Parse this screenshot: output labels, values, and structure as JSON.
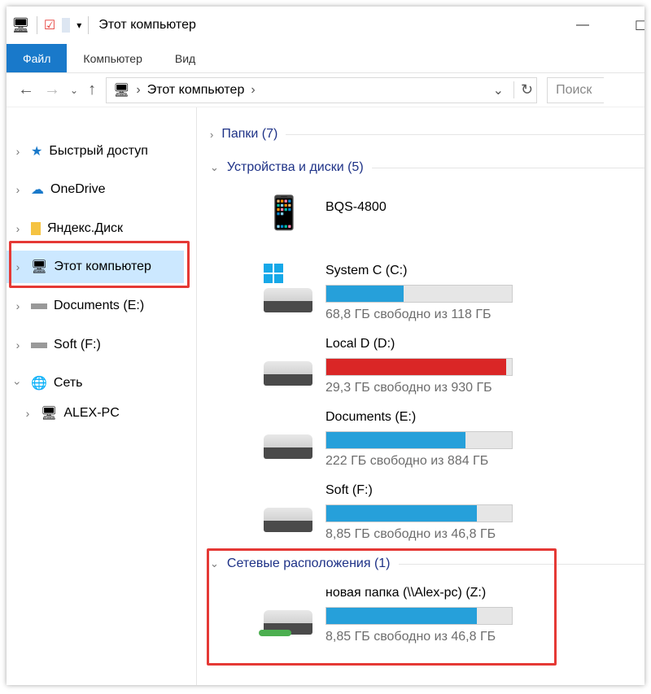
{
  "window": {
    "title": "Этот компьютер"
  },
  "ribbon": {
    "tabs": [
      "Файл",
      "Компьютер",
      "Вид"
    ]
  },
  "address": {
    "path": "Этот компьютер",
    "search_placeholder": "Поиск"
  },
  "sidebar": {
    "items": [
      {
        "label": "Быстрый доступ",
        "icon": "star-icon"
      },
      {
        "label": "OneDrive",
        "icon": "cloud-icon"
      },
      {
        "label": "Яндекс.Диск",
        "icon": "folder-icon"
      },
      {
        "label": "Этот компьютер",
        "icon": "computer-icon",
        "selected": true
      },
      {
        "label": "Documents (E:)",
        "icon": "drive-icon"
      },
      {
        "label": "Soft (F:)",
        "icon": "drive-icon"
      },
      {
        "label": "Сеть",
        "icon": "network-icon",
        "expanded": true
      },
      {
        "label": "ALEX-PC",
        "icon": "computer-icon"
      }
    ]
  },
  "groups": {
    "folders": "Папки (7)",
    "devices": "Устройства и диски (5)",
    "network": "Сетевые расположения (1)"
  },
  "devices": [
    {
      "name": "BQS-4800",
      "icon": "media-player-icon"
    },
    {
      "name": "System C (C:)",
      "free": "68,8 ГБ свободно из 118 ГБ",
      "used_fraction": 0.417,
      "icon": "windows-drive-icon"
    },
    {
      "name": "Local D (D:)",
      "free": "29,3 ГБ свободно из 930 ГБ",
      "used_fraction": 0.968,
      "icon": "drive-icon",
      "warning": true
    },
    {
      "name": "Documents (E:)",
      "free": "222 ГБ свободно из 884 ГБ",
      "used_fraction": 0.749,
      "icon": "drive-icon"
    },
    {
      "name": "Soft (F:)",
      "free": "8,85 ГБ свободно из 46,8 ГБ",
      "used_fraction": 0.811,
      "icon": "drive-icon"
    }
  ],
  "network_locations": [
    {
      "name": "новая папка (\\\\Alex-pc) (Z:)",
      "free": "8,85 ГБ свободно из 46,8 ГБ",
      "used_fraction": 0.811,
      "icon": "network-drive-icon"
    }
  ],
  "colors": {
    "accent": "#1979ca",
    "bar": "#26a0da",
    "bar_warning": "#da2626",
    "highlight": "#e53935",
    "selected": "#cce8ff"
  }
}
